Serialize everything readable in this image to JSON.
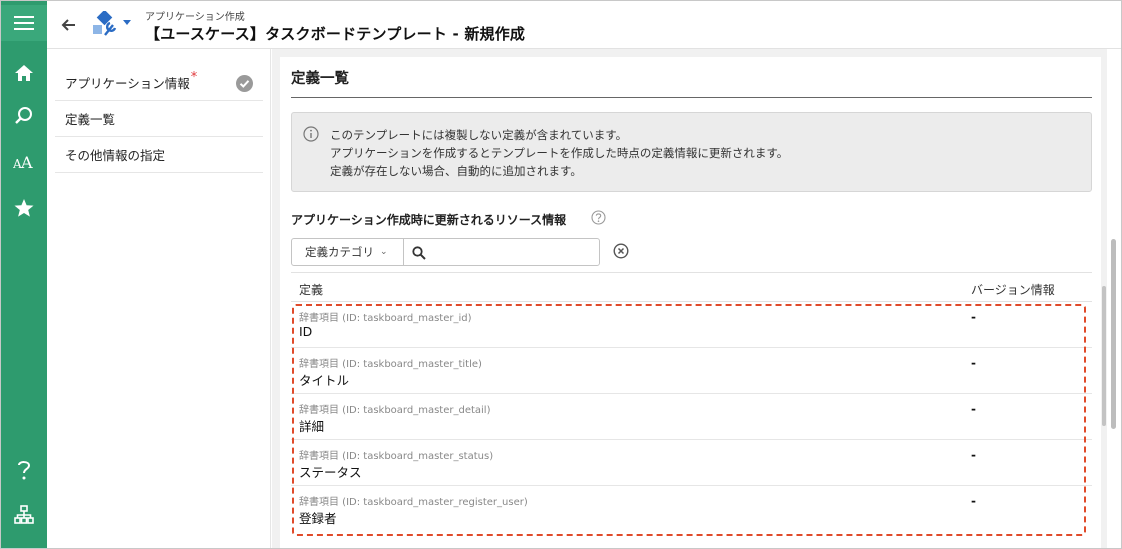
{
  "colors": {
    "rail": "#2e9b6e",
    "accent": "#2b6cc4",
    "highlight": "#e04a2a",
    "required": "#e0383b"
  },
  "rail": {
    "top_icons": [
      "menu-icon",
      "home-icon",
      "search-icon",
      "font-size-icon",
      "star-icon"
    ],
    "bottom_icons": [
      "help-icon",
      "sitemap-icon"
    ]
  },
  "header": {
    "breadcrumb": "アプリケーション作成",
    "title": "【ユースケース】タスクボードテンプレート - 新規作成"
  },
  "nav": {
    "items": [
      {
        "label": "アプリケーション情報",
        "required_mark": "*"
      },
      {
        "label": "定義一覧"
      },
      {
        "label": "その他情報の指定"
      }
    ]
  },
  "section": {
    "title": "定義一覧"
  },
  "info": {
    "lines": [
      "このテンプレートには複製しない定義が含まれています。",
      "アプリケーションを作成するとテンプレートを作成した時点の定義情報に更新されます。",
      "定義が存在しない場合、自動的に追加されます。"
    ]
  },
  "resources": {
    "title": "アプリケーション作成時に更新されるリソース情報",
    "category_label": "定義カテゴリ",
    "search_value": "",
    "columns": {
      "definition": "定義",
      "version": "バージョン情報"
    },
    "rows": [
      {
        "sub": "辞書項目 (ID: taskboard_master_id)",
        "name": "ID",
        "version": "-"
      },
      {
        "sub": "辞書項目 (ID: taskboard_master_title)",
        "name": "タイトル",
        "version": "-"
      },
      {
        "sub": "辞書項目 (ID: taskboard_master_detail)",
        "name": "詳細",
        "version": "-"
      },
      {
        "sub": "辞書項目 (ID: taskboard_master_status)",
        "name": "ステータス",
        "version": "-"
      },
      {
        "sub": "辞書項目 (ID: taskboard_master_register_user)",
        "name": "登録者",
        "version": "-"
      }
    ]
  }
}
